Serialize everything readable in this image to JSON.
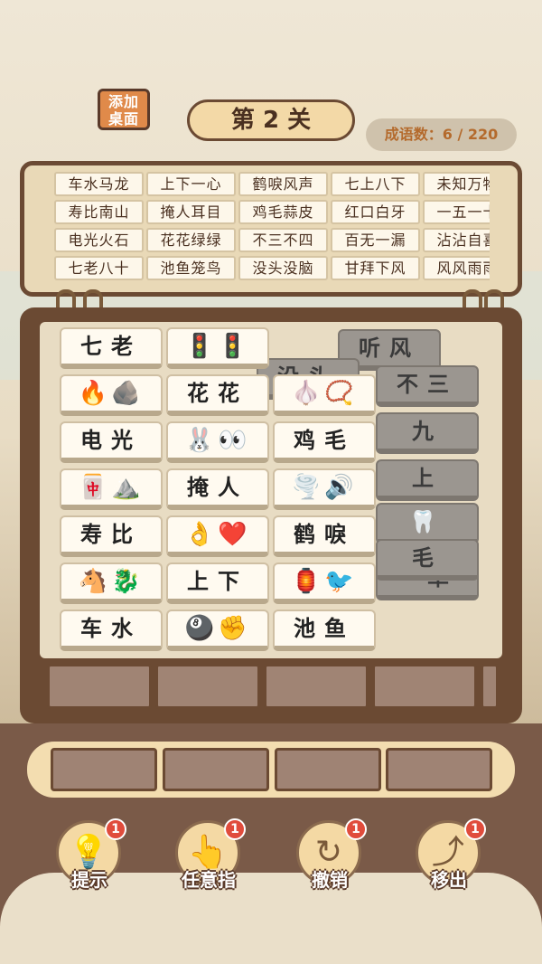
{
  "header": {
    "add_desktop": "添加\n桌面",
    "level": "第 2 关",
    "idiom_count": "成语数：6 / 220"
  },
  "idioms": [
    [
      "车水马龙",
      "上下一心",
      "鹤唳风声",
      "七上八下",
      "未知万物"
    ],
    [
      "寿比南山",
      "掩人耳目",
      "鸡毛蒜皮",
      "红口白牙",
      "一五一十"
    ],
    [
      "电光火石",
      "花花绿绿",
      "不三不四",
      "百无一漏",
      "沾沾自喜"
    ],
    [
      "七老八十",
      "池鱼笼鸟",
      "没头没脑",
      "甘拜下风",
      "风风雨雨"
    ]
  ],
  "front_tiles": [
    {
      "text": "七老"
    },
    {
      "text": "🚦🚦",
      "icon": true
    },
    {
      "text": "🔥🪨",
      "icon": true
    },
    {
      "text": "花花"
    },
    {
      "text": "🧄📿",
      "icon": true
    },
    {
      "text": "电光"
    },
    {
      "text": "🐰👀",
      "icon": true
    },
    {
      "text": "鸡毛"
    },
    {
      "text": "🀄⛰️",
      "icon": true
    },
    {
      "text": "掩人"
    },
    {
      "text": "🌪️🔊",
      "icon": true
    },
    {
      "text": "寿比"
    },
    {
      "text": "👌❤️",
      "icon": true
    },
    {
      "text": "鹤唳"
    },
    {
      "text": "🐴🐉",
      "icon": true
    },
    {
      "text": "上下"
    },
    {
      "text": "🏮🐦",
      "icon": true
    },
    {
      "text": "车水"
    },
    {
      "text": "🎱✊",
      "icon": true
    },
    {
      "text": "池鱼"
    }
  ],
  "back_tiles": [
    "听风",
    "没头",
    "不三",
    "九",
    "上",
    "🦷",
    "一草",
    "毛"
  ],
  "tools": [
    {
      "label": "提示",
      "icon": "lightbulb-icon",
      "glyph": "💡",
      "badge": "1"
    },
    {
      "label": "任意指",
      "icon": "pointing-hand-icon",
      "glyph": "👆",
      "badge": "1"
    },
    {
      "label": "撤销",
      "icon": "undo-icon",
      "glyph": "↻",
      "badge": "1"
    },
    {
      "label": "移出",
      "icon": "move-out-icon",
      "glyph": "⤴",
      "badge": "1"
    }
  ],
  "colors": {
    "frame": "#6b4a33",
    "badge": "#e04c3c",
    "count": "#b46a2c"
  }
}
